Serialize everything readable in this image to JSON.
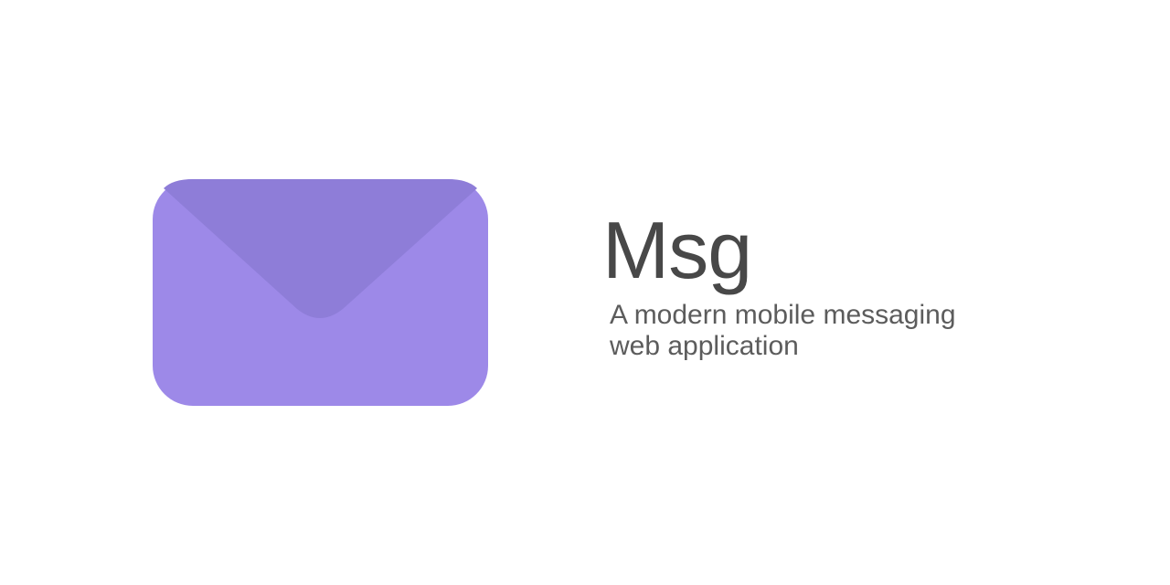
{
  "app": {
    "name": "Msg",
    "tagline": "A modern mobile messaging web application"
  },
  "logo": {
    "icon": "envelope-icon",
    "colors": {
      "body": "#9d89e8",
      "flap": "#8e7dd8"
    }
  },
  "colors": {
    "background": "#ffffff",
    "title_text": "#484848",
    "tagline_text": "#5c5c5c"
  }
}
